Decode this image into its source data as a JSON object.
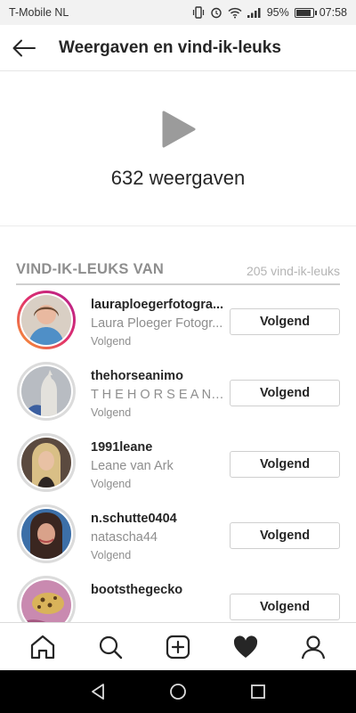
{
  "status_bar": {
    "carrier": "T-Mobile  NL",
    "battery_text": "95%",
    "battery_level": 0.95,
    "time": "07:58",
    "icons": [
      "vibrate-icon",
      "alarm-icon",
      "wifi-icon",
      "signal-icon",
      "battery-icon"
    ]
  },
  "header": {
    "title": "Weergaven en vind-ik-leuks",
    "back_icon": "arrow-left-icon"
  },
  "views": {
    "icon": "play-icon",
    "count_text": "632 weergaven"
  },
  "likes": {
    "title": "VIND-IK-LEUKS VAN",
    "count_text": "205 vind-ik-leuks",
    "items": [
      {
        "username": "lauraploegerfotogra...",
        "full_name": "Laura Ploeger Fotogr...",
        "status": "Volgend",
        "button": "Volgend",
        "story_ring": true
      },
      {
        "username": "thehorseanimo",
        "full_name": "T H E H O R S E A N I ...",
        "status": "Volgend",
        "button": "Volgend",
        "story_ring": false
      },
      {
        "username": "1991leane",
        "full_name": "Leane van Ark",
        "status": "Volgend",
        "button": "Volgend",
        "story_ring": false
      },
      {
        "username": "n.schutte0404",
        "full_name": "natascha44",
        "status": "Volgend",
        "button": "Volgend",
        "story_ring": false
      },
      {
        "username": "bootsthegecko",
        "full_name": "",
        "status": "",
        "button": "Volgend",
        "story_ring": false
      }
    ]
  },
  "bottom_nav": [
    "home-icon",
    "search-icon",
    "add-post-icon",
    "heart-icon",
    "profile-icon"
  ],
  "android_nav": [
    "back-triangle-icon",
    "home-circle-icon",
    "recents-square-icon"
  ],
  "colors": {
    "text": "#262626",
    "secondary": "#8e8e8e",
    "border": "#cfcfcf",
    "story_gradient": [
      "#f9a12e",
      "#e1306c",
      "#b21f8d"
    ]
  }
}
